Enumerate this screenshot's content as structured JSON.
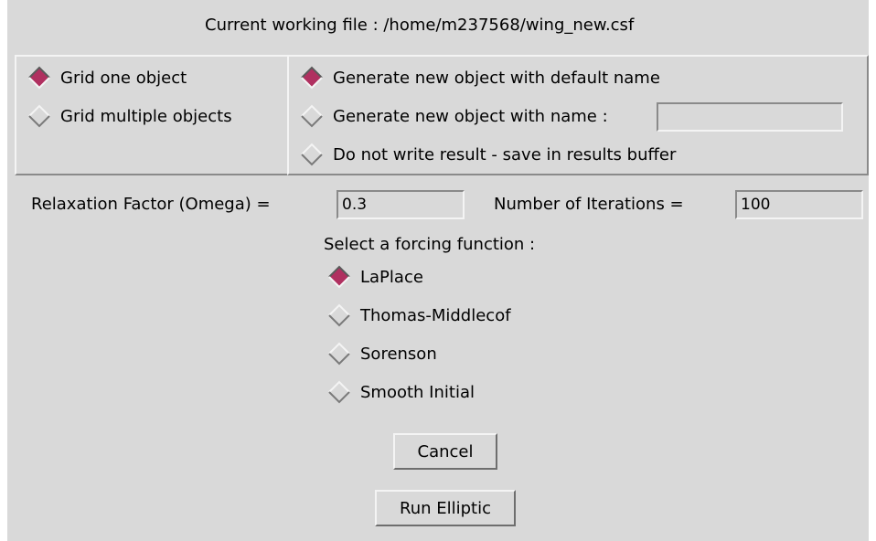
{
  "header": {
    "working_file_label": "Current working file : /home/m237568/wing_new.csf"
  },
  "object_mode": {
    "options": [
      {
        "label": "Grid one object",
        "selected": true
      },
      {
        "label": "Grid multiple objects",
        "selected": false
      }
    ]
  },
  "output_mode": {
    "options": [
      {
        "label": "Generate new object with default name",
        "selected": true
      },
      {
        "label": "Generate new object with name :",
        "selected": false
      },
      {
        "label": "Do not write result - save in results buffer",
        "selected": false
      }
    ],
    "name_value": ""
  },
  "params": {
    "omega_label": "Relaxation Factor (Omega) =",
    "omega_value": "0.3",
    "iterations_label": "Number of Iterations =",
    "iterations_value": "100"
  },
  "forcing": {
    "prompt": "Select a forcing function :",
    "options": [
      {
        "label": "LaPlace",
        "selected": true
      },
      {
        "label": "Thomas-Middlecof",
        "selected": false
      },
      {
        "label": "Sorenson",
        "selected": false
      },
      {
        "label": "Smooth Initial",
        "selected": false
      }
    ]
  },
  "buttons": {
    "cancel_label": "Cancel",
    "run_label": "Run Elliptic"
  },
  "colors": {
    "background": "#d9d9d9",
    "radio_selected": "#b03060",
    "light_edge": "#f4f4f4",
    "dark_edge": "#8a8a8a"
  }
}
